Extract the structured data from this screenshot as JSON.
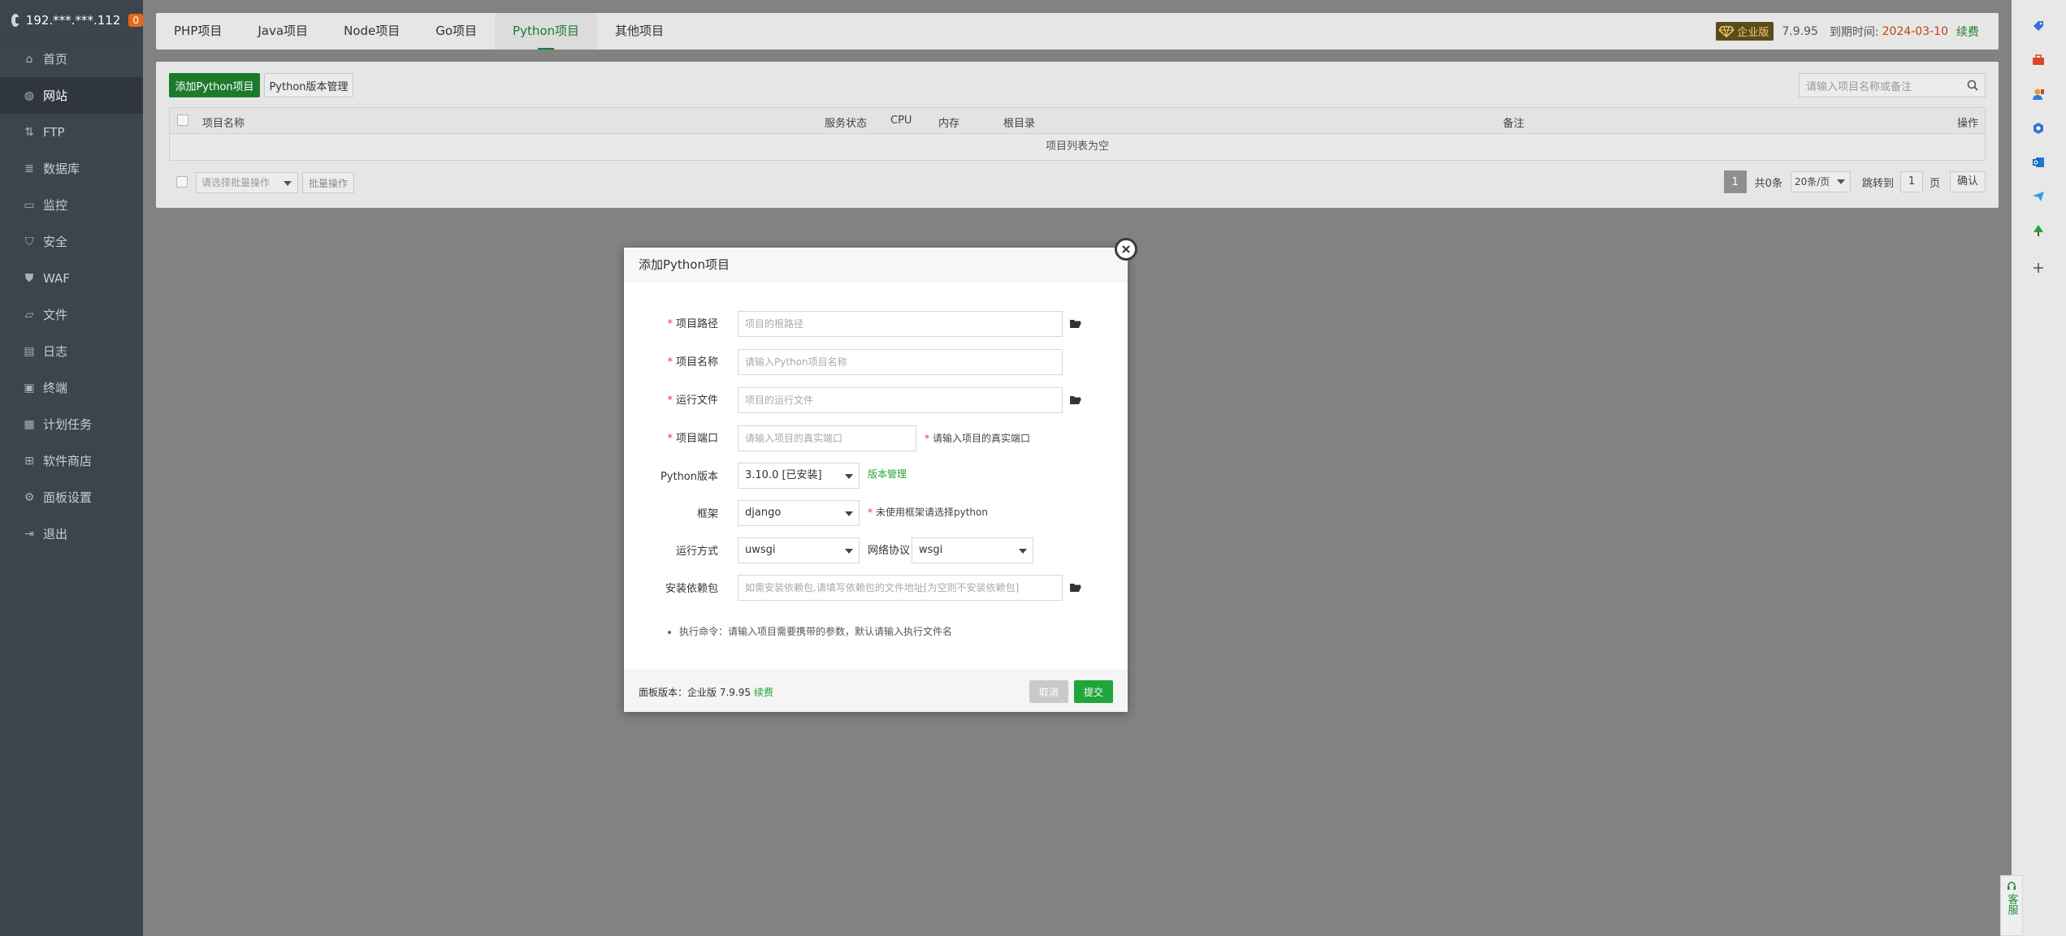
{
  "colors": {
    "sidebar_bg": "#3c444d",
    "accent_green": "#20a53a",
    "overlay": "#828282",
    "expire_red": "#c1440e",
    "badge_orange": "#e8671c"
  },
  "sidebar": {
    "host": "192.***.***.112",
    "badge": "0",
    "items": [
      {
        "label": "首页",
        "icon": "home-icon"
      },
      {
        "label": "网站",
        "icon": "globe-icon"
      },
      {
        "label": "FTP",
        "icon": "ftp-icon"
      },
      {
        "label": "数据库",
        "icon": "database-icon"
      },
      {
        "label": "监控",
        "icon": "monitor-icon"
      },
      {
        "label": "安全",
        "icon": "shield-icon"
      },
      {
        "label": "WAF",
        "icon": "waf-shield-icon"
      },
      {
        "label": "文件",
        "icon": "folder-icon"
      },
      {
        "label": "日志",
        "icon": "log-icon"
      },
      {
        "label": "终端",
        "icon": "terminal-icon"
      },
      {
        "label": "计划任务",
        "icon": "calendar-icon"
      },
      {
        "label": "软件商店",
        "icon": "apps-icon"
      },
      {
        "label": "面板设置",
        "icon": "gear-icon"
      },
      {
        "label": "退出",
        "icon": "logout-icon"
      }
    ]
  },
  "tabs": [
    "PHP项目",
    "Java项目",
    "Node项目",
    "Go项目",
    "Python项目",
    "其他项目"
  ],
  "header_right": {
    "edition": "企业版",
    "version": "7.9.95",
    "expire_label": "到期时间:",
    "expire_date": "2024-03-10",
    "renew": "续费"
  },
  "toolbar": {
    "add_label": "添加Python项目",
    "version_manage_label": "Python版本管理",
    "search_placeholder": "请输入项目名称或备注"
  },
  "table": {
    "columns": [
      "项目名称",
      "服务状态",
      "CPU",
      "内存",
      "根目录",
      "备注",
      "操作"
    ],
    "empty_text": "项目列表为空"
  },
  "bottom": {
    "batch_placeholder": "请选择批量操作",
    "batch_button": "批量操作",
    "page": "1",
    "total": "共0条",
    "per_page": "20条/页",
    "jump_label": "跳转到",
    "jump_value": "1",
    "page_unit": "页",
    "confirm": "确认"
  },
  "right_toolbar": [
    "tag-icon",
    "briefcase-icon",
    "user-icon",
    "cube-icon",
    "outlook-icon",
    "send-icon",
    "tree-icon",
    "plus-icon"
  ],
  "service_label": "客服",
  "modal": {
    "title": "添加Python项目",
    "fields": {
      "path": {
        "label": "项目路径",
        "placeholder": "项目的根路径"
      },
      "name": {
        "label": "项目名称",
        "placeholder": "请输入Python项目名称"
      },
      "run_file": {
        "label": "运行文件",
        "placeholder": "项目的运行文件"
      },
      "port": {
        "label": "项目端口",
        "placeholder": "请输入项目的真实端口",
        "hint": "请输入项目的真实端口"
      },
      "py_version": {
        "label": "Python版本",
        "value": "3.10.0 [已安装]",
        "link": "版本管理"
      },
      "framework": {
        "label": "框架",
        "value": "django",
        "hint": "未使用框架请选择python"
      },
      "run_mode": {
        "label": "运行方式",
        "value": "uwsgi"
      },
      "protocol": {
        "label": "网络协议",
        "value": "wsgi"
      },
      "deps": {
        "label": "安装依赖包",
        "placeholder": "如需安装依赖包,请填写依赖包的文件地址[为空则不安装依赖包]"
      }
    },
    "note": "执行命令：请输入项目需要携带的参数，默认请输入执行文件名",
    "footer": {
      "version_prefix": "面板版本：企业版 7.9.95",
      "renew": "续费",
      "cancel": "取消",
      "submit": "提交"
    }
  }
}
